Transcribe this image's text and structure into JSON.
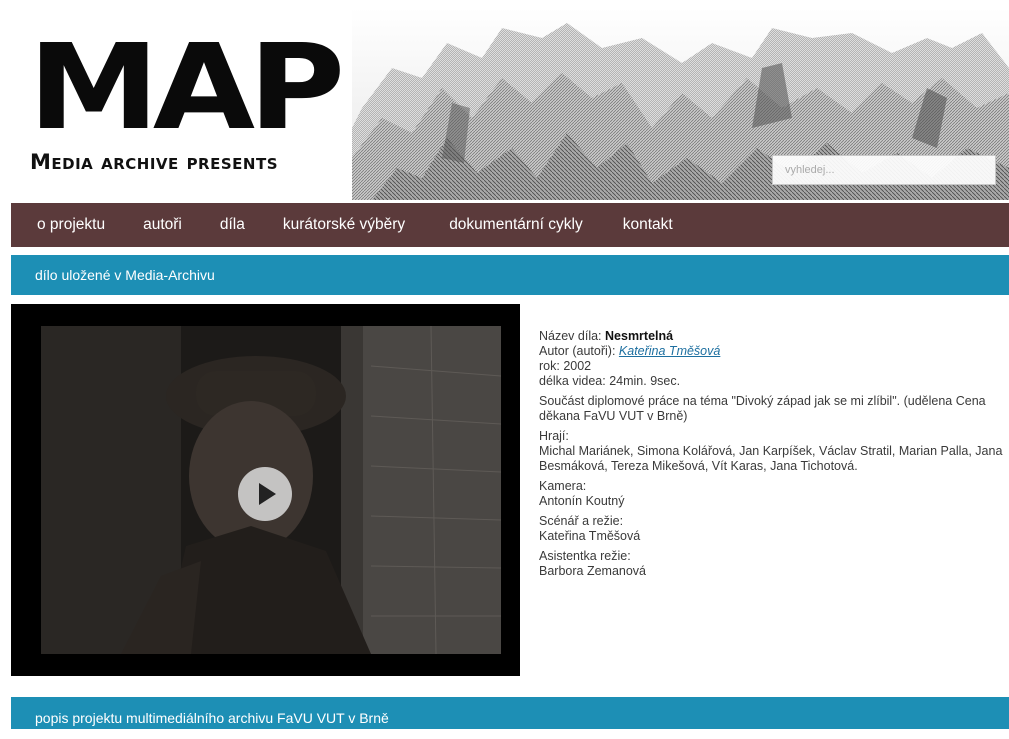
{
  "header": {
    "logo_title": "MAP",
    "logo_subtitle": "Media archive presents",
    "search_placeholder": "vyhledej..."
  },
  "nav": {
    "items": [
      "o projektu",
      "autoři",
      "díla",
      "kurátorské výběry",
      "dokumentární cykly",
      "kontakt"
    ]
  },
  "sections": {
    "top_bar": "dílo uložené v Media-Archivu",
    "bottom_bar": "popis projektu multimediálního archivu FaVU VUT v Brně"
  },
  "video": {
    "play_icon": "play-icon"
  },
  "work": {
    "title_label": "Název díla:",
    "title": "Nesmrtelná",
    "author_label": "Autor (autoři):",
    "author": "Kateřina Tměšová",
    "year_label": "rok:",
    "year": "2002",
    "length_label": "délka videa:",
    "length": "24min. 9sec.",
    "description": "Součást diplomové práce na téma \"Divoký západ jak se mi zlíbil\". (udělena Cena děkana FaVU VUT v Brně)",
    "cast_label": "Hrají:",
    "cast": "Michal Mariánek, Simona Kolářová, Jan Karpíšek, Václav Stratil, Marian Palla, Jana Besmáková, Tereza Mikešová, Vít Karas, Jana Tichotová.",
    "camera_label": "Kamera:",
    "camera": "Antonín Koutný",
    "script_label": "Scénář a režie:",
    "script": "Kateřina Tměšová",
    "assistant_label": "Asistentka režie:",
    "assistant": "Barbora Zemanová"
  },
  "colors": {
    "nav_bg": "#5b3a3b",
    "section_bar": "#1d8fb5",
    "link": "#1d6fa0"
  }
}
